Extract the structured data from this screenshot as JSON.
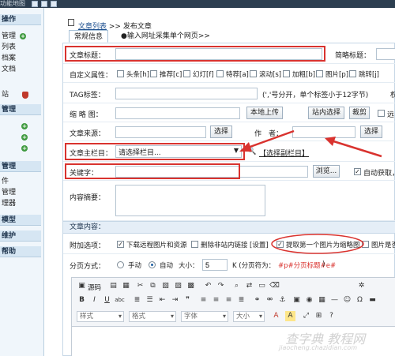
{
  "topbar": {
    "title": "功能地图"
  },
  "sidebar": {
    "items": [
      {
        "label": "操作",
        "kind": "head"
      },
      {
        "label": "管理",
        "kind": "item",
        "plus": true
      },
      {
        "label": "列表",
        "kind": "item"
      },
      {
        "label": "档案",
        "kind": "item"
      },
      {
        "label": "文档",
        "kind": "item"
      },
      {
        "label": "站",
        "kind": "item",
        "shield": true
      },
      {
        "label": "管理",
        "kind": "head"
      },
      {
        "label": "",
        "kind": "item",
        "plus": true
      },
      {
        "label": "",
        "kind": "item",
        "plus": true
      },
      {
        "label": "",
        "kind": "item",
        "plus": true
      },
      {
        "label": "管理",
        "kind": "head"
      },
      {
        "label": "件",
        "kind": "item"
      },
      {
        "label": "管理",
        "kind": "item"
      },
      {
        "label": "理器",
        "kind": "item"
      },
      {
        "label": "模型",
        "kind": "head"
      },
      {
        "label": "维护",
        "kind": "head"
      },
      {
        "label": "帮助",
        "kind": "head"
      }
    ]
  },
  "breadcrumb": {
    "link": "文章列表",
    "sep": ">>",
    "current": "发布文章"
  },
  "tabs": {
    "basic": "常规信息",
    "collect": "●输入网址采集单个网页>>"
  },
  "form": {
    "title_label": "文章标题：",
    "short_title_label": "简略标题：",
    "custom_attr_label": "自定义属性：",
    "attrs": [
      "头条[h]",
      "推荐[c]",
      "幻灯[f]",
      "特荐[a]",
      "滚动[s]",
      "加粗[b]",
      "图片[p]",
      "跳转[j]"
    ],
    "tag_label": "TAG标签：",
    "tag_hint": "(','号分开，单个标签小于12字节)",
    "tag_tail": "权",
    "thumb_label": "缩 略 图：",
    "upload_btn": "本地上传",
    "site_select_btn": "站内选择",
    "crop_btn": "裁剪",
    "remote_label": "远",
    "source_label": "文章来源：",
    "select_btn": "选择",
    "author_label": "作　者：",
    "author_select_btn": "选择",
    "category_label": "文章主栏目：",
    "category_value": "请选择栏目...",
    "sub_category": "【选择副栏目】",
    "keyword_label": "关键字：",
    "browse_btn": "浏览...",
    "auto_fetch": "自动获取，",
    "summary_label": "内容摘要：",
    "content_head": "文章内容：",
    "extra_label": "附加选项：",
    "opt_download": "下载远程图片和资源",
    "opt_remove_links": "删除非站内链接",
    "opt_settings": "[设置]",
    "opt_first_image": "提取第一个图片为缩略图",
    "opt_image_tail": "图片是否",
    "paging_label": "分页方式：",
    "paging_manual": "手动",
    "paging_auto": "自动",
    "size_label": "大小：",
    "size_value": "5",
    "size_unit": "K (分页符为：",
    "page_break": "#p#分页标题#e#",
    "page_break_tail": ")"
  },
  "editor": {
    "source": "源码",
    "style_label": "样式",
    "format_label": "格式",
    "font_label": "字体",
    "size_label": "大小"
  },
  "watermark": {
    "text": "查字典 教程网",
    "url": "jiaocheng.chazidian.com"
  }
}
